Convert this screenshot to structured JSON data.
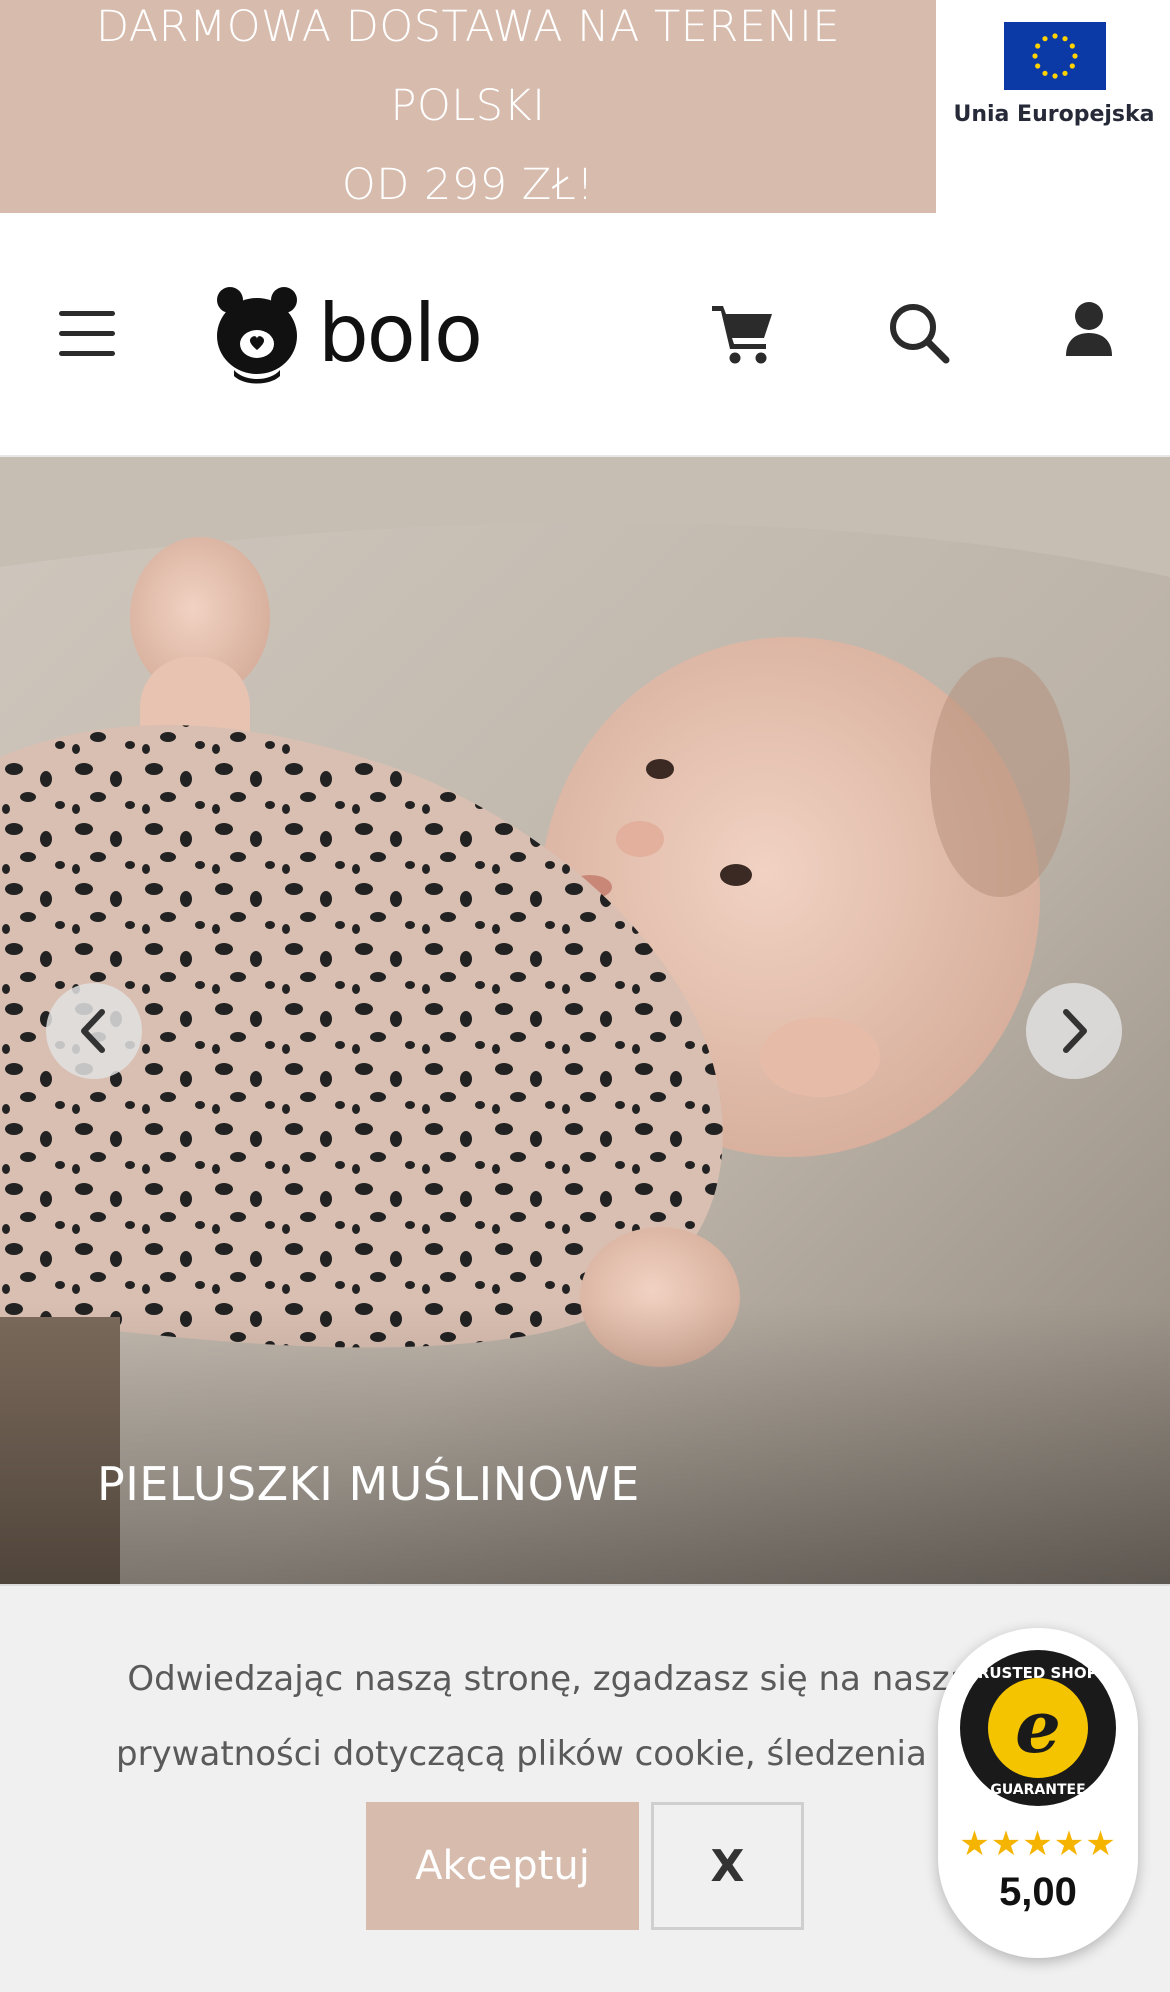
{
  "promo": {
    "line1": "DARMOWA DOSTAWA NA TERENIE POLSKI",
    "line2": "OD 299 ZŁ!",
    "color": "#d7bbad"
  },
  "eu_badge": {
    "label": "Unia Europejska",
    "flag_icon": "eu-flag-icon"
  },
  "header": {
    "logo_text": "bolo",
    "icons": [
      "menu-icon",
      "cart-icon",
      "search-icon",
      "user-icon"
    ]
  },
  "hero": {
    "caption": "PIELUSZKI MUŚLINOWE",
    "prev_icon": "chevron-left-icon",
    "next_icon": "chevron-right-icon"
  },
  "cookie": {
    "line1": "Odwiedzając naszą stronę, zgadzasz się na naszą poli",
    "line2": "prywatności dotyczącą plików cookie, śledzenia statyst",
    "accept_label": "Akceptuj",
    "close_label": "X"
  },
  "trusted_shops": {
    "seal_top_text": "TRUSTED SHOPS",
    "seal_bottom_text": "GUARANTEE",
    "stars": "★★★★★",
    "rating": "5,00"
  }
}
